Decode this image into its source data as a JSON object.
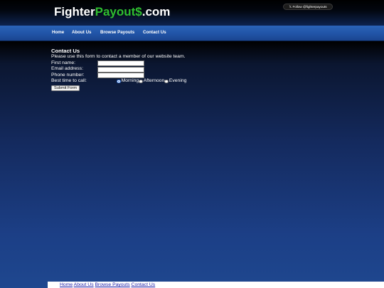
{
  "header": {
    "logo": {
      "part1": "Fighter",
      "part2": "Payout$",
      "part3": ".com"
    },
    "twitter_follow": "𝕏 Follow @fighterpayouts"
  },
  "nav": {
    "items": [
      {
        "label": "Home"
      },
      {
        "label": "About Us"
      },
      {
        "label": "Browse Payouts"
      },
      {
        "label": "Contact Us"
      }
    ]
  },
  "main": {
    "title": "Contact Us",
    "intro": "Please use this form to contact a member of our website team.",
    "fields": [
      {
        "label": "First name:",
        "value": ""
      },
      {
        "label": "Email address:",
        "value": ""
      },
      {
        "label": "Phone number:",
        "value": ""
      }
    ],
    "best_time": {
      "label": "Best time to call:",
      "options": [
        "Morning",
        "Afternoon",
        "Evening"
      ],
      "selected": "Morning"
    },
    "submit_label": "Submit Form"
  },
  "footer": {
    "links": [
      "Home",
      "About Us",
      "Browse Payouts",
      "Contact Us"
    ]
  },
  "colors": {
    "logo_green": "#2fbf2f",
    "nav_blue": "#2154a6",
    "footer_link": "#1a1aa6"
  }
}
